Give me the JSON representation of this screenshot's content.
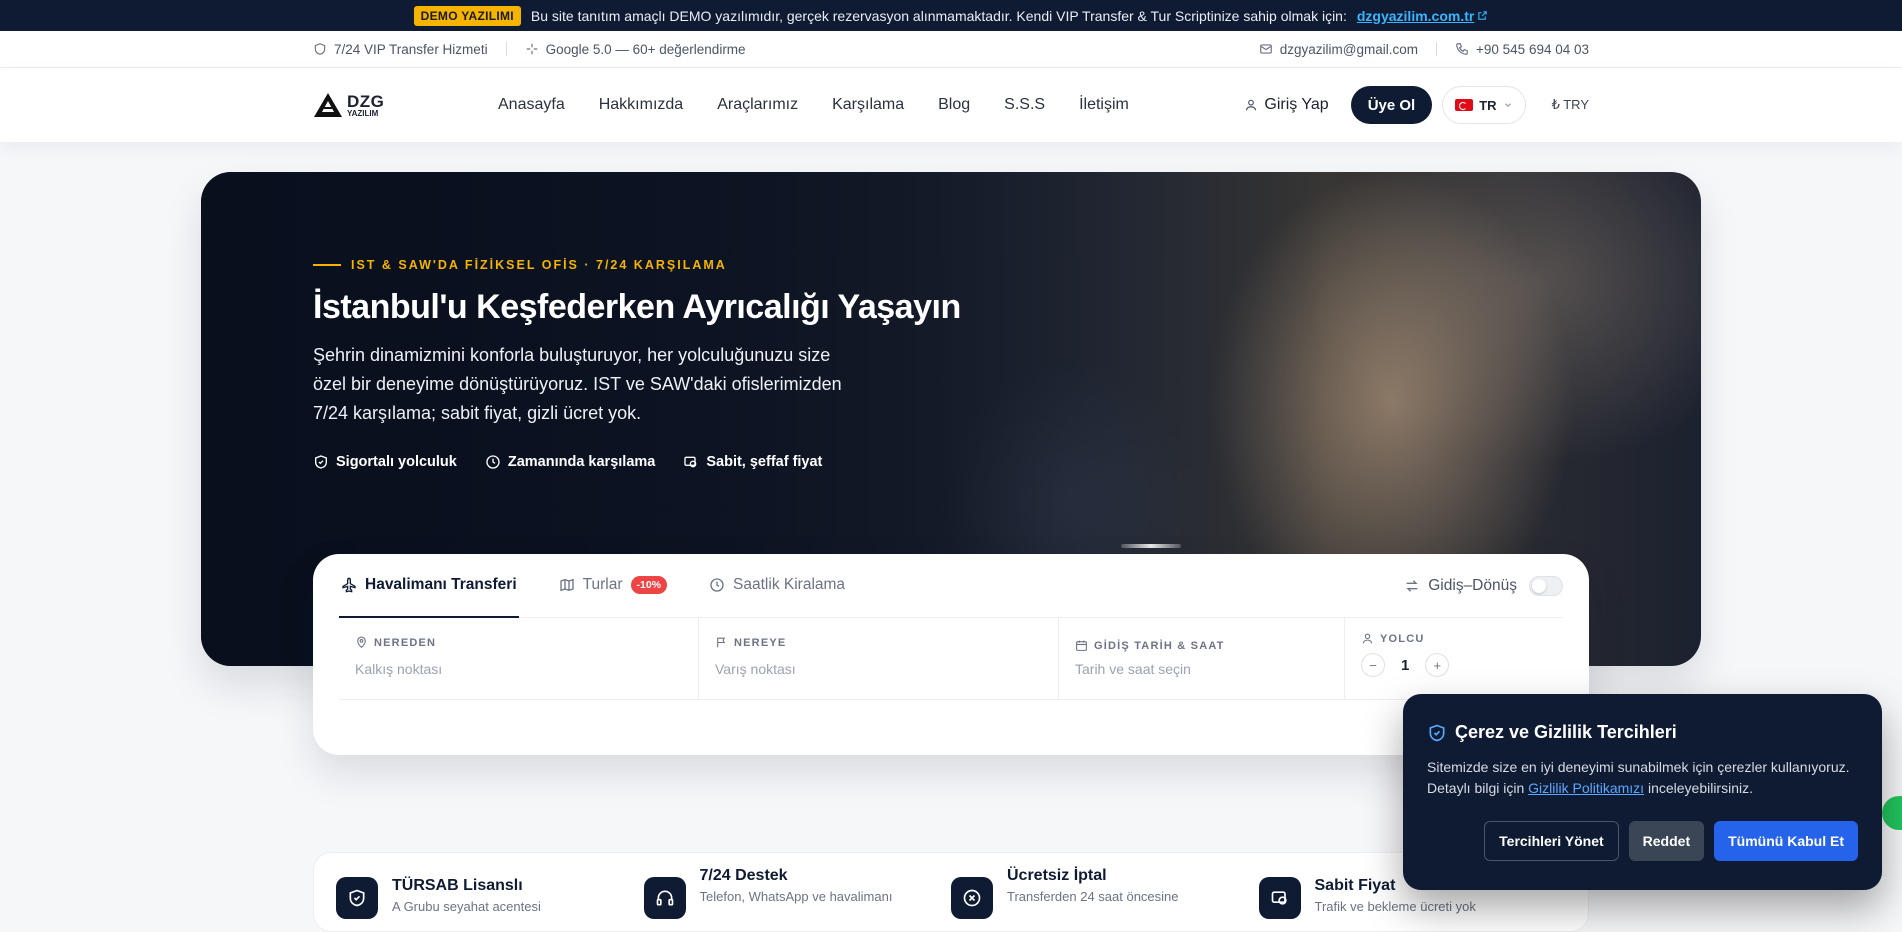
{
  "demo_bar": {
    "badge": "DEMO YAZILIMI",
    "message": "Bu site tanıtım amaçlı DEMO yazılımıdır, gerçek rezervasyon alınmamaktadır. Kendi VIP Transfer & Tur Scriptinize sahip olmak için:",
    "link_text": "dzgyazilim.com.tr"
  },
  "info_bar": {
    "service": "7/24 VIP Transfer Hizmeti",
    "rating": "Google 5.0 — 60+ değerlendirme",
    "email": "dzgyazilim@gmail.com",
    "phone": "+90 545 694 04 03"
  },
  "header": {
    "logo_main": "DZG",
    "logo_sub": "YAZILIM",
    "nav": [
      "Anasayfa",
      "Hakkımızda",
      "Araçlarımız",
      "Karşılama",
      "Blog",
      "S.S.S",
      "İletişim"
    ],
    "login": "Giriş Yap",
    "signup": "Üye Ol",
    "language": "TR",
    "currency": "₺ TRY"
  },
  "hero": {
    "eyebrow": "IST & SAW'DA FİZİKSEL OFİS · 7/24 KARŞILAMA",
    "title": "İstanbul'u Keşfederken Ayrıcalığı Yaşayın",
    "subtitle": "Şehrin dinamizmini konforla buluşturuyor, her yolculuğunuzu size özel bir deneyime dönüştürüyoruz. IST ve SAW'daki ofislerimizden 7/24 karşılama; sabit fiyat, gizli ücret yok.",
    "features": [
      "Sigortalı yolculuk",
      "Zamanında karşılama",
      "Sabit, şeffaf fiyat"
    ]
  },
  "booking": {
    "tabs": [
      "Havalimanı Transferi",
      "Turlar",
      "Saatlik Kiralama"
    ],
    "discount_badge": "-10%",
    "roundtrip_label": "Gidiş–Dönüş",
    "fields": {
      "from_label": "NEREDEN",
      "from_placeholder": "Kalkış noktası",
      "to_label": "NEREYE",
      "to_placeholder": "Varış noktası",
      "date_label": "GİDİŞ TARİH & SAAT",
      "date_placeholder": "Tarih ve saat seçin",
      "pax_label": "YOLCU",
      "pax_value": "1"
    }
  },
  "features": [
    {
      "title": "TÜRSAB Lisanslı",
      "desc": "A Grubu seyahat acentesi"
    },
    {
      "title": "7/24 Destek",
      "desc": "Telefon, WhatsApp ve havalimanı"
    },
    {
      "title": "Ücretsiz İptal",
      "desc": "Transferden 24 saat öncesine"
    },
    {
      "title": "Sabit Fiyat",
      "desc": "Trafik ve bekleme ücreti yok"
    }
  ],
  "cookie": {
    "title": "Çerez ve Gizlilik Tercihleri",
    "text_before": "Sitemizde size en iyi deneyimi sunabilmek için çerezler kullanıyoruz. Detaylı bilgi için",
    "link": "Gizlilik Politikamızı",
    "text_after": "inceleyebilirsiniz.",
    "manage": "Tercihleri Yönet",
    "reject": "Reddet",
    "accept_all": "Tümünü Kabul Et"
  },
  "colors": {
    "navy": "#0f1b33",
    "accent": "#f5b400",
    "link_blue": "#38b6ff",
    "primary_blue": "#2563eb",
    "discount_red": "#ef4444"
  }
}
